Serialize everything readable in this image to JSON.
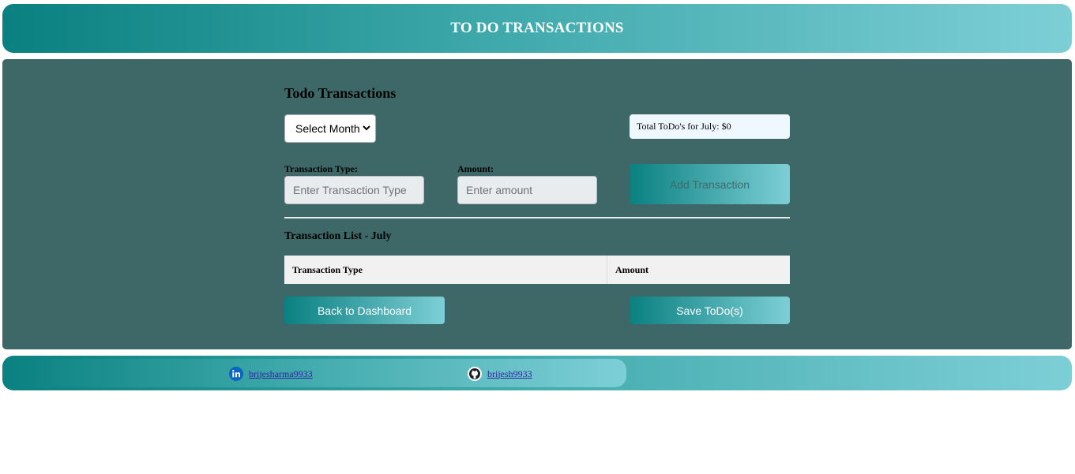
{
  "header": {
    "title": "TO DO TRANSACTIONS"
  },
  "panel": {
    "title": "Todo Transactions",
    "month_select": {
      "selected": "Select Month"
    },
    "total_label": "Total ToDo's for July: $0"
  },
  "form": {
    "type_label": "Transaction Type:",
    "type_placeholder": "Enter Transaction Type",
    "amount_label": "Amount:",
    "amount_placeholder": "Enter amount",
    "add_button": "Add Transaction"
  },
  "list": {
    "title": "Transaction List - July",
    "columns": [
      "Transaction Type",
      "Amount"
    ],
    "rows": []
  },
  "actions": {
    "back_button": "Back to Dashboard",
    "save_button": "Save ToDo(s)"
  },
  "footer": {
    "linkedin": {
      "handle": "brijesharma9933",
      "icon": "linkedin-icon"
    },
    "github": {
      "handle": "brijesh9933",
      "icon": "github-icon"
    }
  },
  "colors": {
    "gradient_start": "#0a8080",
    "gradient_end": "#7dcfd6",
    "panel_bg": "#3e6868",
    "total_bg": "#f0f8ff"
  }
}
